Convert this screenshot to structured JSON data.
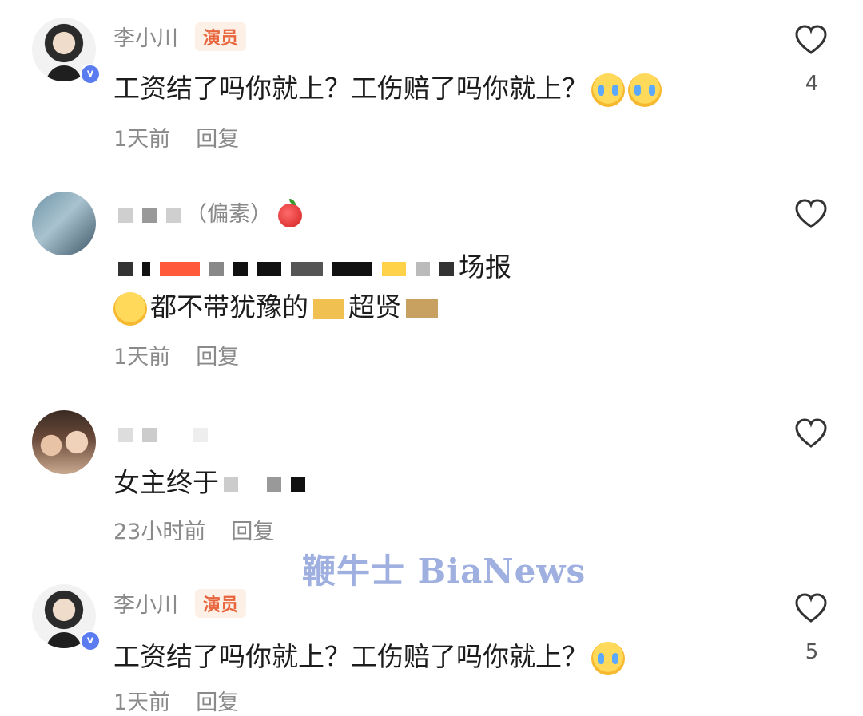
{
  "comments": [
    {
      "name": "李小川",
      "badge": "演员",
      "text": "工资结了吗你就上？工伤赔了吗你就上？",
      "time": "1天前",
      "reply": "回复",
      "likes": "4",
      "emojis": [
        "crying-face",
        "crying-face"
      ]
    },
    {
      "name": "（偏素）",
      "text_end": "场报",
      "text_line2": "都不带犹豫的",
      "text_line2_tail": "超贤",
      "time": "1天前",
      "reply": "回复"
    },
    {
      "text": "女主终于",
      "time": "23小时前",
      "reply": "回复"
    },
    {
      "name": "李小川",
      "badge": "演员",
      "text": "工资结了吗你就上？工伤赔了吗你就上？",
      "time": "1天前",
      "reply": "回复",
      "likes": "5",
      "emojis": [
        "crying-face"
      ]
    }
  ],
  "watermark": "鞭牛士 BiaNews"
}
